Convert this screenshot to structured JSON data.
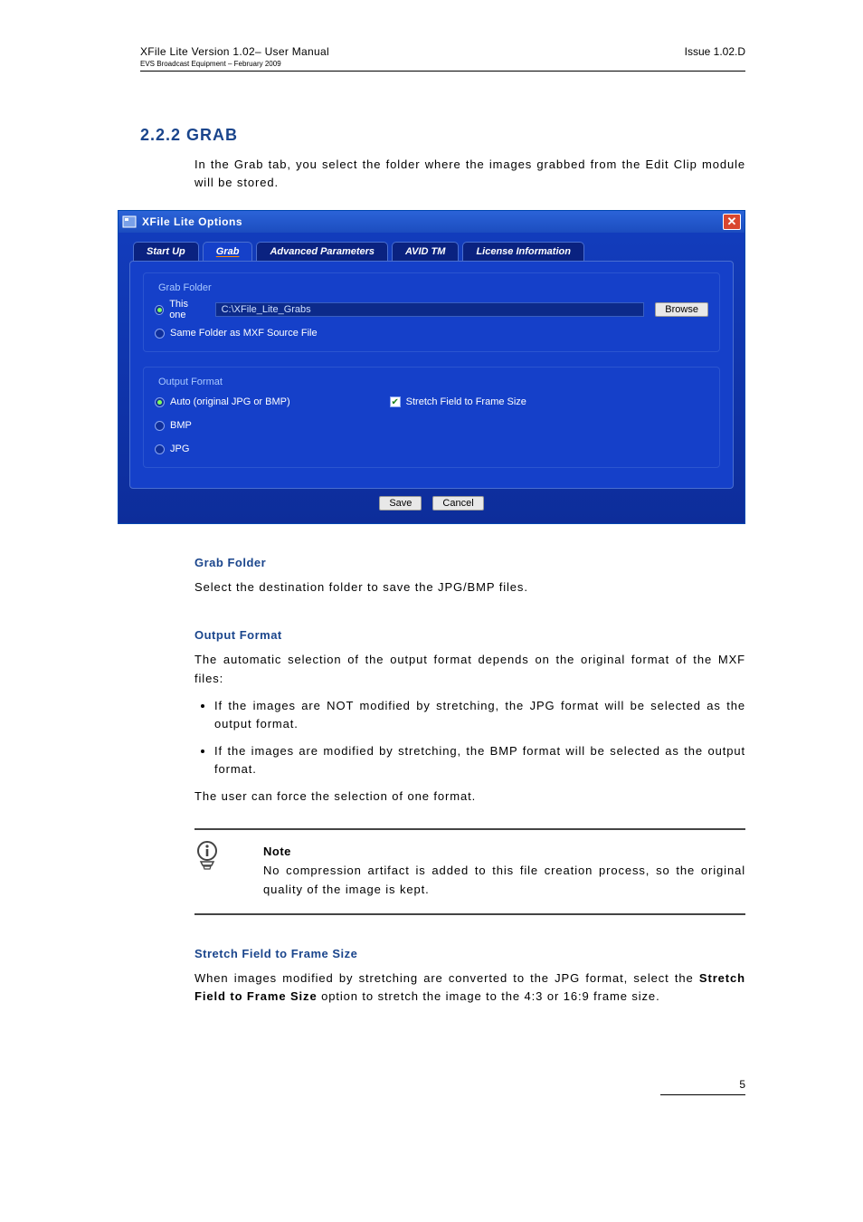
{
  "header": {
    "left_line1": "XFile Lite Version 1.02– User Manual",
    "left_line2": "EVS Broadcast Equipment – February 2009",
    "right": "Issue 1.02.D"
  },
  "section_heading_grab": "2.2.2 GRAB",
  "intro_text": "In the Grab tab, you select the folder where the images grabbed from the Edit Clip module will be stored.",
  "dialog": {
    "title": "XFile Lite Options",
    "tabs": {
      "startup": "Start Up",
      "grab": "Grab",
      "advanced": "Advanced Parameters",
      "avid": "AVID TM",
      "license": "License Information"
    },
    "grab_folder": {
      "legend": "Grab Folder",
      "this_one_label": "This one",
      "path_value": "C:\\XFile_Lite_Grabs",
      "browse": "Browse",
      "same_folder_label": "Same Folder as MXF Source File"
    },
    "output_format": {
      "legend": "Output Format",
      "auto_label": "Auto (original JPG or BMP)",
      "bmp_label": "BMP",
      "jpg_label": "JPG",
      "stretch_label": "Stretch Field to Frame Size"
    },
    "actions": {
      "save": "Save",
      "cancel": "Cancel"
    }
  },
  "subsection_grab_folder_heading": "Grab Folder",
  "grab_folder_text": "Select the destination folder to save the JPG/BMP files.",
  "subsection_output_format_heading": "Output Format",
  "output_format_intro": "The automatic selection of the output format depends on the original format of the MXF files:",
  "output_bullet_1": "If the images are NOT modified by stretching, the JPG format will be selected as the output format.",
  "output_bullet_2": "If the images are modified by stretching, the BMP format will be selected as the output format.",
  "output_format_footer": "The user can force the selection of one format.",
  "note": {
    "heading": "Note",
    "text": "No compression artifact is added to this file creation process, so the original quality of the image is kept."
  },
  "subsection_stretch_heading": "Stretch Field to Frame Size",
  "stretch_text_1": "When images modified by stretching are converted to the JPG format, select the ",
  "stretch_bold": "Stretch Field to Frame Size",
  "stretch_text_2": " option to stretch the image to the 4:3 or 16:9 frame size.",
  "page_number": "5"
}
